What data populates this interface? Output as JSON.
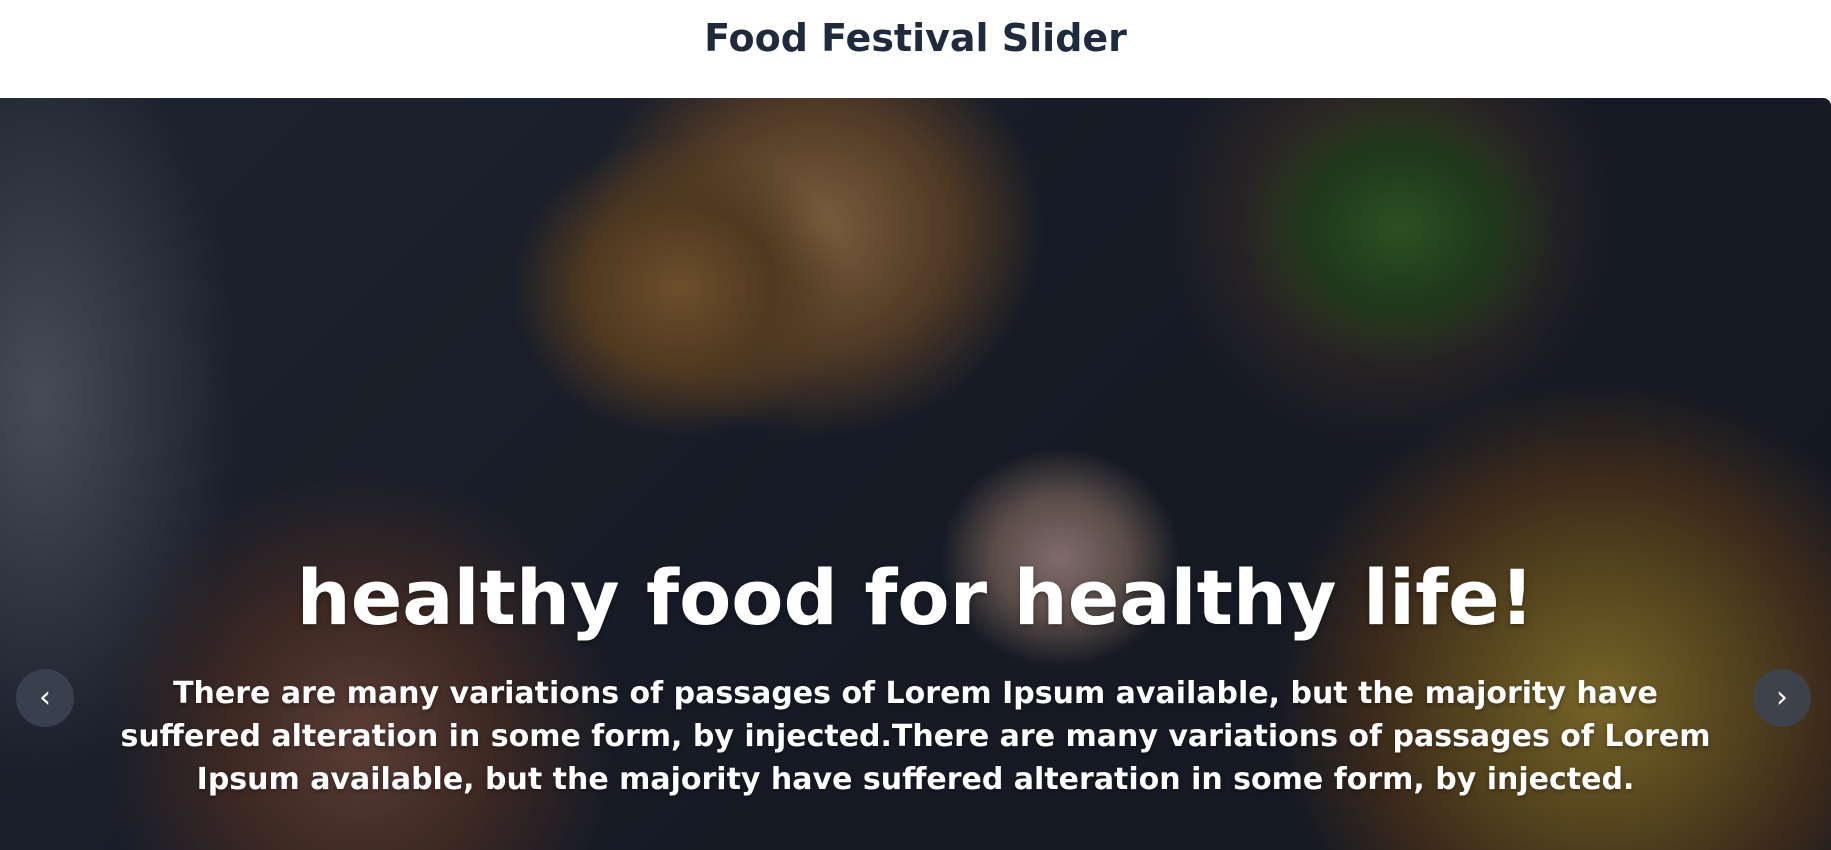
{
  "header": {
    "title": "Food Festival Slider"
  },
  "slider": {
    "current_slide": {
      "heading": "healthy food for healthy life!",
      "description": "There are many variations of passages of Lorem Ipsum available, but the majority have suffered alteration in some form, by injected.There are many variations of passages of Lorem Ipsum available, but the majority have suffered alteration in some form, by injected."
    },
    "controls": {
      "prev_icon": "‹",
      "next_icon": "›"
    }
  },
  "colors": {
    "title_text": "#1f2a3c",
    "slide_text": "#ffffff",
    "nav_button_bg": "#3c4454"
  }
}
